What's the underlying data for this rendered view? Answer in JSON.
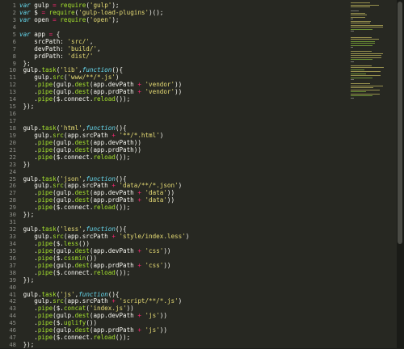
{
  "editor": {
    "line_numbers": [
      "1",
      "2",
      "3",
      "4",
      "5",
      "6",
      "7",
      "8",
      "9",
      "10",
      "11",
      "12",
      "13",
      "14",
      "15",
      "16",
      "17",
      "18",
      "19",
      "20",
      "21",
      "22",
      "23",
      "24",
      "25",
      "26",
      "27",
      "28",
      "29",
      "30",
      "31",
      "32",
      "33",
      "34",
      "35",
      "36",
      "37",
      "38",
      "39",
      "40",
      "41",
      "42",
      "43",
      "44",
      "45",
      "46",
      "47",
      "48"
    ],
    "lines": [
      [
        [
          "kw",
          "var"
        ],
        [
          "plain",
          " gulp "
        ],
        [
          "op",
          "="
        ],
        [
          "plain",
          " "
        ],
        [
          "fn",
          "require"
        ],
        [
          "plain",
          "("
        ],
        [
          "str",
          "'gulp'"
        ],
        [
          "plain",
          ");"
        ]
      ],
      [
        [
          "kw",
          "var"
        ],
        [
          "plain",
          " $ "
        ],
        [
          "op",
          "="
        ],
        [
          "plain",
          " "
        ],
        [
          "fn",
          "require"
        ],
        [
          "plain",
          "("
        ],
        [
          "str",
          "'gulp-load-plugins'"
        ],
        [
          "plain",
          ")();"
        ]
      ],
      [
        [
          "kw",
          "var"
        ],
        [
          "plain",
          " open "
        ],
        [
          "op",
          "="
        ],
        [
          "plain",
          " "
        ],
        [
          "fn",
          "require"
        ],
        [
          "plain",
          "("
        ],
        [
          "str",
          "'open'"
        ],
        [
          "plain",
          ");"
        ]
      ],
      [
        [
          "plain",
          ""
        ]
      ],
      [
        [
          "kw",
          "var"
        ],
        [
          "plain",
          " app "
        ],
        [
          "op",
          "="
        ],
        [
          "plain",
          " {"
        ]
      ],
      [
        [
          "plain",
          "    srcPath: "
        ],
        [
          "str",
          "'src/'"
        ],
        [
          "plain",
          ","
        ]
      ],
      [
        [
          "plain",
          "    devPath: "
        ],
        [
          "str",
          "'build/'"
        ],
        [
          "plain",
          ","
        ]
      ],
      [
        [
          "plain",
          "    prdPath: "
        ],
        [
          "str",
          "'dist/'"
        ]
      ],
      [
        [
          "plain",
          " };"
        ]
      ],
      [
        [
          "plain",
          " gulp."
        ],
        [
          "fn",
          "task"
        ],
        [
          "plain",
          "("
        ],
        [
          "str",
          "'lib'"
        ],
        [
          "plain",
          ","
        ],
        [
          "kw",
          "function"
        ],
        [
          "plain",
          "(){"
        ]
      ],
      [
        [
          "plain",
          "    gulp."
        ],
        [
          "fn",
          "src"
        ],
        [
          "plain",
          "("
        ],
        [
          "str",
          "'www/**/*.js'"
        ],
        [
          "plain",
          ")"
        ]
      ],
      [
        [
          "plain",
          "    ."
        ],
        [
          "fn",
          "pipe"
        ],
        [
          "plain",
          "(gulp."
        ],
        [
          "fn",
          "dest"
        ],
        [
          "plain",
          "(app.devPath "
        ],
        [
          "op",
          "+"
        ],
        [
          "plain",
          " "
        ],
        [
          "str",
          "'vendor'"
        ],
        [
          "plain",
          "))"
        ]
      ],
      [
        [
          "plain",
          "    ."
        ],
        [
          "fn",
          "pipe"
        ],
        [
          "plain",
          "(gulp."
        ],
        [
          "fn",
          "dest"
        ],
        [
          "plain",
          "(app.prdPath "
        ],
        [
          "op",
          "+"
        ],
        [
          "plain",
          " "
        ],
        [
          "str",
          "'vendor'"
        ],
        [
          "plain",
          "))"
        ]
      ],
      [
        [
          "plain",
          "    ."
        ],
        [
          "fn",
          "pipe"
        ],
        [
          "plain",
          "($.connect."
        ],
        [
          "fn",
          "reload"
        ],
        [
          "plain",
          "());"
        ]
      ],
      [
        [
          "plain",
          " });"
        ]
      ],
      [
        [
          "plain",
          ""
        ]
      ],
      [
        [
          "plain",
          ""
        ]
      ],
      [
        [
          "plain",
          " gulp."
        ],
        [
          "fn",
          "task"
        ],
        [
          "plain",
          "("
        ],
        [
          "str",
          "'html'"
        ],
        [
          "plain",
          ","
        ],
        [
          "kw",
          "function"
        ],
        [
          "plain",
          "(){"
        ]
      ],
      [
        [
          "plain",
          "    gulp."
        ],
        [
          "fn",
          "src"
        ],
        [
          "plain",
          "(app.srcPath "
        ],
        [
          "op",
          "+"
        ],
        [
          "plain",
          " "
        ],
        [
          "str",
          "'**/*.html'"
        ],
        [
          "plain",
          ")"
        ]
      ],
      [
        [
          "plain",
          "    ."
        ],
        [
          "fn",
          "pipe"
        ],
        [
          "plain",
          "(gulp."
        ],
        [
          "fn",
          "dest"
        ],
        [
          "plain",
          "(app.devPath))"
        ]
      ],
      [
        [
          "plain",
          "    ."
        ],
        [
          "fn",
          "pipe"
        ],
        [
          "plain",
          "(gulp."
        ],
        [
          "fn",
          "dest"
        ],
        [
          "plain",
          "(app.prdPath))"
        ]
      ],
      [
        [
          "plain",
          "    ."
        ],
        [
          "fn",
          "pipe"
        ],
        [
          "plain",
          "($.connect."
        ],
        [
          "fn",
          "reload"
        ],
        [
          "plain",
          "());"
        ]
      ],
      [
        [
          "plain",
          " })"
        ]
      ],
      [
        [
          "plain",
          ""
        ]
      ],
      [
        [
          "plain",
          " gulp."
        ],
        [
          "fn",
          "task"
        ],
        [
          "plain",
          "("
        ],
        [
          "str",
          "'json'"
        ],
        [
          "plain",
          ","
        ],
        [
          "kw",
          "function"
        ],
        [
          "plain",
          "(){"
        ]
      ],
      [
        [
          "plain",
          "    gulp."
        ],
        [
          "fn",
          "src"
        ],
        [
          "plain",
          "(app.srcPath "
        ],
        [
          "op",
          "+"
        ],
        [
          "plain",
          " "
        ],
        [
          "str",
          "'data/**/*.json'"
        ],
        [
          "plain",
          ")"
        ]
      ],
      [
        [
          "plain",
          "    ."
        ],
        [
          "fn",
          "pipe"
        ],
        [
          "plain",
          "(gulp."
        ],
        [
          "fn",
          "dest"
        ],
        [
          "plain",
          "(app.devPath "
        ],
        [
          "op",
          "+"
        ],
        [
          "plain",
          " "
        ],
        [
          "str",
          "'data'"
        ],
        [
          "plain",
          "))"
        ]
      ],
      [
        [
          "plain",
          "    ."
        ],
        [
          "fn",
          "pipe"
        ],
        [
          "plain",
          "(gulp."
        ],
        [
          "fn",
          "dest"
        ],
        [
          "plain",
          "(app.prdPath "
        ],
        [
          "op",
          "+"
        ],
        [
          "plain",
          " "
        ],
        [
          "str",
          "'data'"
        ],
        [
          "plain",
          "))"
        ]
      ],
      [
        [
          "plain",
          "    ."
        ],
        [
          "fn",
          "pipe"
        ],
        [
          "plain",
          "($.connect."
        ],
        [
          "fn",
          "reload"
        ],
        [
          "plain",
          "());"
        ]
      ],
      [
        [
          "plain",
          " });"
        ]
      ],
      [
        [
          "plain",
          ""
        ]
      ],
      [
        [
          "plain",
          " gulp."
        ],
        [
          "fn",
          "task"
        ],
        [
          "plain",
          "("
        ],
        [
          "str",
          "'less'"
        ],
        [
          "plain",
          ","
        ],
        [
          "kw",
          "function"
        ],
        [
          "plain",
          "(){"
        ]
      ],
      [
        [
          "plain",
          "    gulp."
        ],
        [
          "fn",
          "src"
        ],
        [
          "plain",
          "(app.srcPath "
        ],
        [
          "op",
          "+"
        ],
        [
          "plain",
          " "
        ],
        [
          "str",
          "'style/index.less'"
        ],
        [
          "plain",
          ")"
        ]
      ],
      [
        [
          "plain",
          "    ."
        ],
        [
          "fn",
          "pipe"
        ],
        [
          "plain",
          "($."
        ],
        [
          "fn",
          "less"
        ],
        [
          "plain",
          "())"
        ]
      ],
      [
        [
          "plain",
          "    ."
        ],
        [
          "fn",
          "pipe"
        ],
        [
          "plain",
          "(gulp."
        ],
        [
          "fn",
          "dest"
        ],
        [
          "plain",
          "(app.devPath "
        ],
        [
          "op",
          "+"
        ],
        [
          "plain",
          " "
        ],
        [
          "str",
          "'css'"
        ],
        [
          "plain",
          "))"
        ]
      ],
      [
        [
          "plain",
          "    ."
        ],
        [
          "fn",
          "pipe"
        ],
        [
          "plain",
          "($."
        ],
        [
          "fn",
          "cssmin"
        ],
        [
          "plain",
          "())"
        ]
      ],
      [
        [
          "plain",
          "    ."
        ],
        [
          "fn",
          "pipe"
        ],
        [
          "plain",
          "(gulp."
        ],
        [
          "fn",
          "dest"
        ],
        [
          "plain",
          "(app.prdPath "
        ],
        [
          "op",
          "+"
        ],
        [
          "plain",
          " "
        ],
        [
          "str",
          "'css'"
        ],
        [
          "plain",
          "))"
        ]
      ],
      [
        [
          "plain",
          "    ."
        ],
        [
          "fn",
          "pipe"
        ],
        [
          "plain",
          "($.connect."
        ],
        [
          "fn",
          "reload"
        ],
        [
          "plain",
          "());"
        ]
      ],
      [
        [
          "plain",
          " });"
        ]
      ],
      [
        [
          "plain",
          ""
        ]
      ],
      [
        [
          "plain",
          " gulp."
        ],
        [
          "fn",
          "task"
        ],
        [
          "plain",
          "("
        ],
        [
          "str",
          "'js'"
        ],
        [
          "plain",
          ","
        ],
        [
          "kw",
          "function"
        ],
        [
          "plain",
          "(){"
        ]
      ],
      [
        [
          "plain",
          "    gulp."
        ],
        [
          "fn",
          "src"
        ],
        [
          "plain",
          "(app.srcPath "
        ],
        [
          "op",
          "+"
        ],
        [
          "plain",
          " "
        ],
        [
          "str",
          "'script/**/*.js'"
        ],
        [
          "plain",
          ")"
        ]
      ],
      [
        [
          "plain",
          "    ."
        ],
        [
          "fn",
          "pipe"
        ],
        [
          "plain",
          "($."
        ],
        [
          "fn",
          "concat"
        ],
        [
          "plain",
          "("
        ],
        [
          "str",
          "'index.js'"
        ],
        [
          "plain",
          "))"
        ]
      ],
      [
        [
          "plain",
          "    ."
        ],
        [
          "fn",
          "pipe"
        ],
        [
          "plain",
          "(gulp."
        ],
        [
          "fn",
          "dest"
        ],
        [
          "plain",
          "(app.devPath "
        ],
        [
          "op",
          "+"
        ],
        [
          "plain",
          " "
        ],
        [
          "str",
          "'js'"
        ],
        [
          "plain",
          "))"
        ]
      ],
      [
        [
          "plain",
          "    ."
        ],
        [
          "fn",
          "pipe"
        ],
        [
          "plain",
          "($."
        ],
        [
          "fn",
          "uglify"
        ],
        [
          "plain",
          "())"
        ]
      ],
      [
        [
          "plain",
          "    ."
        ],
        [
          "fn",
          "pipe"
        ],
        [
          "plain",
          "(gulp."
        ],
        [
          "fn",
          "dest"
        ],
        [
          "plain",
          "(app.prdPath "
        ],
        [
          "op",
          "+"
        ],
        [
          "plain",
          " "
        ],
        [
          "str",
          "'js'"
        ],
        [
          "plain",
          "))"
        ]
      ],
      [
        [
          "plain",
          "    ."
        ],
        [
          "fn",
          "pipe"
        ],
        [
          "plain",
          "($.connect."
        ],
        [
          "fn",
          "reload"
        ],
        [
          "plain",
          "());"
        ]
      ],
      [
        [
          "plain",
          " });"
        ]
      ]
    ]
  },
  "colors": {
    "background": "#272822",
    "keyword": "#66d9ef",
    "string": "#e6db74",
    "operator": "#f92672",
    "function": "#a6e22e",
    "text": "#f8f8f2",
    "line_number": "#8f908a"
  }
}
